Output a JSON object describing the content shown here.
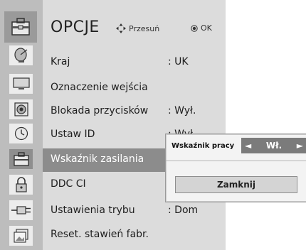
{
  "header": {
    "title": "OPCJE",
    "nav_hint": "Przesuń",
    "ok_hint": "OK"
  },
  "sidebar": {
    "icons": [
      "satellite-dish-icon",
      "monitor-icon",
      "speaker-icon",
      "clock-icon",
      "toolbox-icon",
      "lock-icon",
      "plug-icon",
      "photos-icon"
    ]
  },
  "menu": {
    "items": [
      {
        "label": "Kraj",
        "value": ": UK"
      },
      {
        "label": "Oznaczenie wejścia",
        "value": ""
      },
      {
        "label": "Blokada przycisków",
        "value": ": Wył."
      },
      {
        "label": "Ustaw ID",
        "value": ": Wył."
      },
      {
        "label": "Wskaźnik zasilania",
        "value": ""
      },
      {
        "label": "DDC CI",
        "value": ""
      },
      {
        "label": "Ustawienia trybu",
        "value": ": Dom"
      },
      {
        "label": "Reset. stawień fabr.",
        "value": ""
      }
    ],
    "selected_index": 4
  },
  "popup": {
    "label": "Wskaźnik pracy",
    "value": "Wł.",
    "close_label": "Zamknij"
  },
  "colors": {
    "osd_bg": "#dcdcdc",
    "icon_column": "#bdbdbd",
    "selected_row": "#8c8c8c",
    "value_box": "#7b7b7b"
  }
}
